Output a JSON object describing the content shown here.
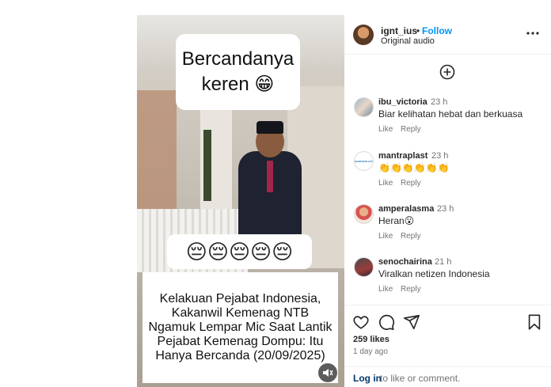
{
  "post": {
    "video_overlay_title": [
      "Bercandanya",
      "keren 😁"
    ],
    "video_overlay_emojis": "😔😔😔😔😔",
    "video_caption": "Kelakuan Pejabat Indonesia, Kakanwil Kemenag NTB Ngamuk Lempar Mic Saat Lantik Pejabat Kemenag Dompu: Itu Hanya Bercanda (20/09/2025)"
  },
  "header": {
    "username": "ignt_ius",
    "separator": "•",
    "follow_label": "Follow",
    "audio_label": "Original audio"
  },
  "comments": [
    {
      "username": "ibu_victoria",
      "time": "23 h",
      "text": "Biar kelihatan hebat dan berkuasa",
      "like": "Like",
      "reply": "Reply"
    },
    {
      "username": "mantraplast",
      "time": "23 h",
      "text": "👏👏👏👏👏👏",
      "like": "Like",
      "reply": "Reply",
      "avatar_text": "MANTRAPLAST"
    },
    {
      "username": "amperalasma",
      "time": "23 h",
      "text": "Heran😮",
      "like": "Like",
      "reply": "Reply"
    },
    {
      "username": "senochairina",
      "time": "21 h",
      "text": "Viralkan netizen Indonesia",
      "like": "Like",
      "reply": "Reply"
    }
  ],
  "footer": {
    "likes": "259 likes",
    "posted": "1 day ago",
    "login_link": "Log in",
    "login_rest": "to like or comment."
  },
  "icons": {
    "more": "more-options-icon",
    "add": "add-comment-icon",
    "like": "heart-icon",
    "comment": "comment-icon",
    "share": "share-icon",
    "save": "bookmark-icon",
    "mute": "speaker-icon"
  },
  "colors": {
    "follow": "#0095f6",
    "link": "#00376b",
    "muted": "#737373"
  }
}
